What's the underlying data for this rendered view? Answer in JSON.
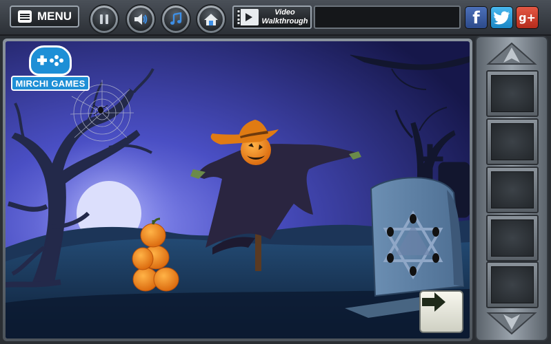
{
  "toolbar": {
    "menu_label": "MENU",
    "video_line1": "Video",
    "video_line2": "Walkthrough",
    "buttons": [
      "pause-icon",
      "sound-icon",
      "music-icon",
      "home-icon"
    ],
    "social": {
      "facebook": "f",
      "twitter": "t",
      "googleplus": "g+"
    }
  },
  "logo": {
    "text": "MIRCHI GAMES",
    "color": "#1e8fd6"
  },
  "scene": {
    "sky_color": "#3b3fa8",
    "moon_color": "#d9dcfb",
    "ground_color": "#1f3e62",
    "pumpkin_color": "#f08a1f",
    "tombstone_symbol": "hexagram-icon"
  },
  "navigation": {
    "next_icon": "right-arrow-icon"
  },
  "inventory": {
    "slot_count": 5,
    "up_icon": "up-arrow-icon",
    "down_icon": "down-arrow-icon"
  }
}
